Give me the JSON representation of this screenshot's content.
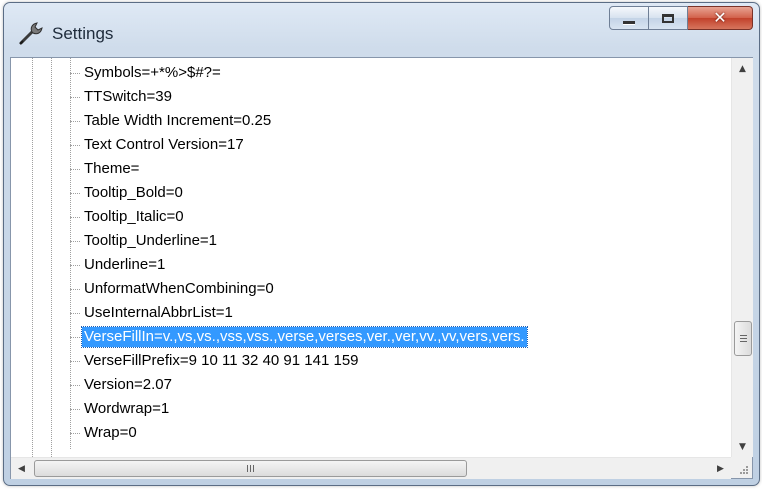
{
  "window": {
    "title": "Settings",
    "icon": "wrench-icon",
    "caption_buttons": [
      "minimize",
      "maximize",
      "close"
    ]
  },
  "tree": {
    "items": [
      {
        "label": "Symbols=+*%>$#?=",
        "selected": false
      },
      {
        "label": "TTSwitch=39",
        "selected": false
      },
      {
        "label": "Table Width Increment=0.25",
        "selected": false
      },
      {
        "label": "Text Control Version=17",
        "selected": false
      },
      {
        "label": "Theme=",
        "selected": false
      },
      {
        "label": "Tooltip_Bold=0",
        "selected": false
      },
      {
        "label": "Tooltip_Italic=0",
        "selected": false
      },
      {
        "label": "Tooltip_Underline=1",
        "selected": false
      },
      {
        "label": "Underline=1",
        "selected": false
      },
      {
        "label": "UnformatWhenCombining=0",
        "selected": false
      },
      {
        "label": "UseInternalAbbrList=1",
        "selected": false
      },
      {
        "label": "VerseFillIn=v.,vs,vs.,vss,vss.,verse,verses,ver.,ver,vv.,vv,vers,vers.",
        "selected": true
      },
      {
        "label": "VerseFillPrefix=9 10 11 32 40 91 141 159",
        "selected": false
      },
      {
        "label": "Version=2.07",
        "selected": false
      },
      {
        "label": "Wordwrap=1",
        "selected": false
      },
      {
        "label": "Wrap=0",
        "selected": false
      }
    ]
  },
  "colors": {
    "selection": "#3399ff",
    "close_button": "#c8452f"
  }
}
